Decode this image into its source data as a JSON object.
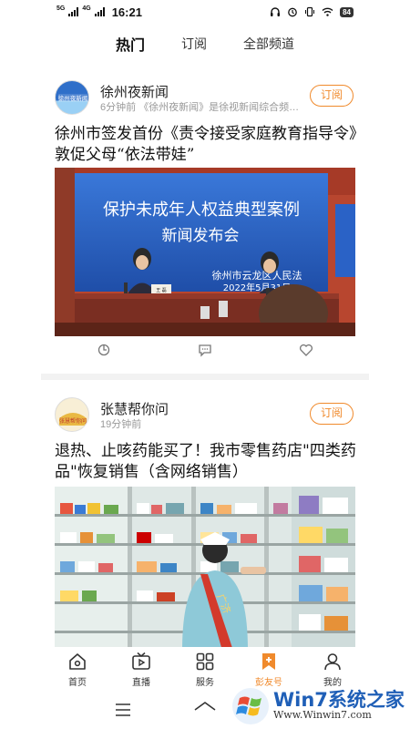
{
  "status_bar": {
    "net1": "5G",
    "net2": "4G",
    "time": "16:21",
    "battery": "84"
  },
  "tabs": [
    {
      "label": "热门",
      "active": true
    },
    {
      "label": "订阅",
      "active": false
    },
    {
      "label": "全部频道",
      "active": false
    }
  ],
  "feed": [
    {
      "source": "徐州夜新闻",
      "avatar_text": "徐州夜新闻",
      "time": "6分钟前",
      "desc": "《徐州夜新闻》是徐视新闻综合频…",
      "subscribe_label": "订阅",
      "title": "徐州市签发首份《责令接受家庭教育指导令》敦促父母“依法带娃”",
      "photo": {
        "banner_line1": "保护未成年人权益典型案例",
        "banner_line2": "新闻发布会",
        "org": "徐州市云龙区人民法",
        "date": "2022年5月31日",
        "nameplate": "王 磊"
      },
      "actions": [
        "share-icon",
        "comment-icon",
        "like-icon"
      ]
    },
    {
      "source": "张慧帮你问",
      "avatar_text": "张慧帮你问",
      "time": "19分钟前",
      "subscribe_label": "订阅",
      "title": "退热、止咳药能买了！我市零售药店\"四类药品\"恢复销售（含网络销售）",
      "photo": {
        "sash_text": "广济"
      }
    }
  ],
  "bottom_nav": [
    {
      "label": "首页",
      "icon": "home-icon",
      "active": false
    },
    {
      "label": "直播",
      "icon": "live-tv-icon",
      "active": false
    },
    {
      "label": "服务",
      "icon": "grid-icon",
      "active": false
    },
    {
      "label": "彭友号",
      "icon": "bookmark-icon",
      "active": true
    },
    {
      "label": "我的",
      "icon": "user-icon",
      "active": false
    }
  ],
  "watermark": {
    "brand": "Win7系统之家",
    "url": "Www.Winwin7.com"
  },
  "colors": {
    "accent": "#f08a2c",
    "banner_blue": "#2a62c6",
    "divider": "#f2f2f2",
    "meta_gray": "#999999"
  }
}
